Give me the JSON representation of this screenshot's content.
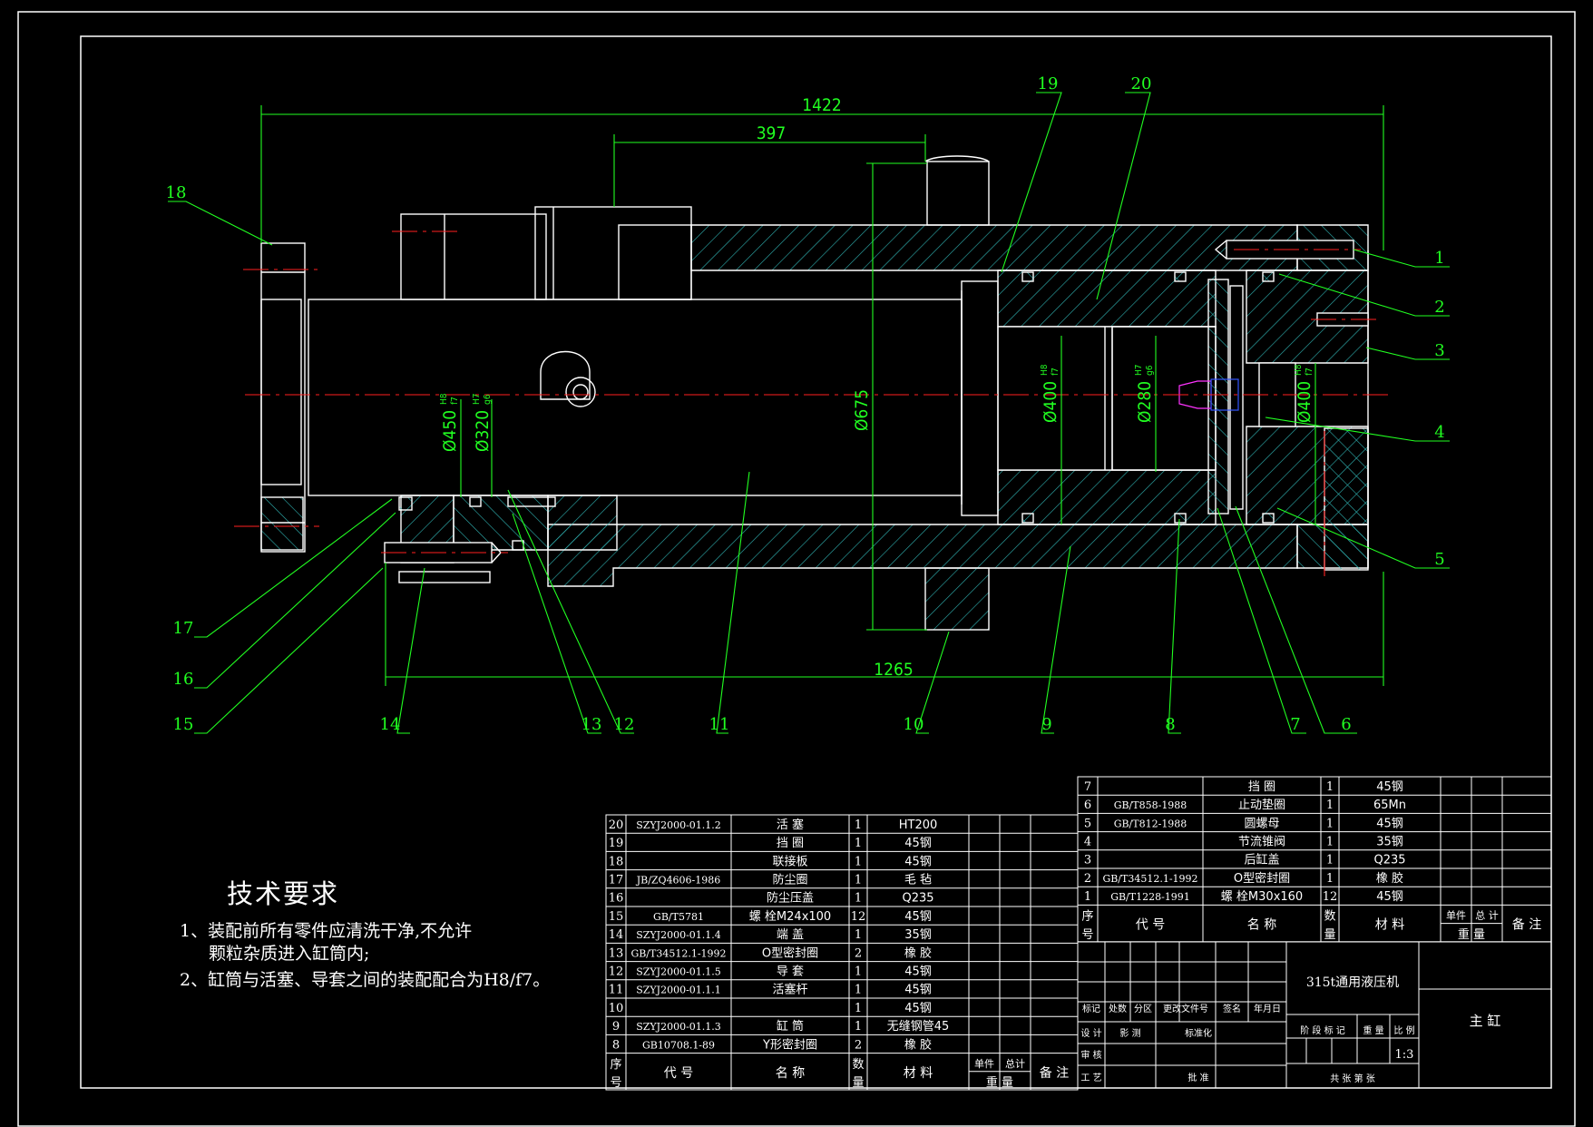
{
  "colors": {
    "background": "#000000",
    "frame": "#ffffff",
    "outline": "#ffffff",
    "dimension": "#21ff21",
    "centerline": "#ff2020",
    "hatch": "#2fb3b3",
    "accent_magenta": "#ff33ff",
    "accent_blue": "#3355ff"
  },
  "dimensions": {
    "overall_length": "1422",
    "cylinder_length": "1265",
    "flange_offset": "397",
    "diameter_flange": "Ø675",
    "diameter_gland": "Ø450",
    "gland_fit_top": "H8",
    "gland_fit_bottom": "f7",
    "diameter_rod": "Ø320",
    "rod_fit_top": "H7",
    "rod_fit_bottom": "g6",
    "diameter_bore_left": "Ø400",
    "bore_left_fit_top": "H8",
    "bore_left_fit_bottom": "f7",
    "diameter_piston_inner": "Ø280",
    "piston_fit_top": "H7",
    "piston_fit_bottom": "g6",
    "diameter_bore_right": "Ø400",
    "bore_right_fit_top": "H8",
    "bore_right_fit_bottom": "f7"
  },
  "balloons": [
    "1",
    "2",
    "3",
    "4",
    "5",
    "6",
    "7",
    "8",
    "9",
    "10",
    "11",
    "12",
    "13",
    "14",
    "15",
    "16",
    "17",
    "18",
    "19",
    "20"
  ],
  "tech_requirements": {
    "title": "技术要求",
    "line1": "1、装配前所有零件应清洗干净,不允许",
    "line1b": "颗粒杂质进入缸筒内;",
    "line2": "2、缸筒与活塞、导套之间的装配配合为H8/f7。"
  },
  "bom_left": {
    "rows": [
      {
        "no": "20",
        "code": "SZYJ2000-01.1.2",
        "name": "活 塞",
        "qty": "1",
        "material": "HT200"
      },
      {
        "no": "19",
        "code": "",
        "name": "挡 圈",
        "qty": "1",
        "material": "45钢"
      },
      {
        "no": "18",
        "code": "",
        "name": "联接板",
        "qty": "1",
        "material": "45钢"
      },
      {
        "no": "17",
        "code": "JB/ZQ4606-1986",
        "name": "防尘圈",
        "qty": "1",
        "material": "毛 毡"
      },
      {
        "no": "16",
        "code": "",
        "name": "防尘压盖",
        "qty": "1",
        "material": "Q235"
      },
      {
        "no": "15",
        "code": "GB/T5781",
        "name": "螺 栓M24x100",
        "qty": "12",
        "material": "45钢"
      },
      {
        "no": "14",
        "code": "SZYJ2000-01.1.4",
        "name": "端 盖",
        "qty": "1",
        "material": "35钢"
      },
      {
        "no": "13",
        "code": "GB/T34512.1-1992",
        "name": "O型密封圈",
        "qty": "2",
        "material": "橡 胶"
      },
      {
        "no": "12",
        "code": "SZYJ2000-01.1.5",
        "name": "导 套",
        "qty": "1",
        "material": "45钢"
      },
      {
        "no": "11",
        "code": "SZYJ2000-01.1.1",
        "name": "活塞杆",
        "qty": "1",
        "material": "45钢"
      },
      {
        "no": "10",
        "code": "",
        "name": "",
        "qty": "1",
        "material": "45钢"
      },
      {
        "no": "9",
        "code": "SZYJ2000-01.1.3",
        "name": "缸 筒",
        "qty": "1",
        "material": "无缝钢管45"
      },
      {
        "no": "8",
        "code": "GB10708.1-89",
        "name": "Y形密封圈",
        "qty": "2",
        "material": "橡 胶"
      }
    ],
    "header": {
      "no_top": "序",
      "no_bottom": "号",
      "code": "代 号",
      "name": "名 称",
      "qty_top": "数",
      "qty_bottom": "量",
      "material": "材 料",
      "unit": "单件",
      "total": "总计",
      "weight": "重 量",
      "remark": "备 注"
    }
  },
  "bom_right": {
    "rows": [
      {
        "no": "7",
        "code": "",
        "name": "挡 圈",
        "qty": "1",
        "material": "45钢"
      },
      {
        "no": "6",
        "code": "GB/T858-1988",
        "name": "止动垫圈",
        "qty": "1",
        "material": "65Mn"
      },
      {
        "no": "5",
        "code": "GB/T812-1988",
        "name": "圆螺母",
        "qty": "1",
        "material": "45钢"
      },
      {
        "no": "4",
        "code": "",
        "name": "节流锥阀",
        "qty": "1",
        "material": "35钢"
      },
      {
        "no": "3",
        "code": "",
        "name": "后缸盖",
        "qty": "1",
        "material": "Q235"
      },
      {
        "no": "2",
        "code": "GB/T34512.1-1992",
        "name": "O型密封圈",
        "qty": "1",
        "material": "橡 胶"
      },
      {
        "no": "1",
        "code": "GB/T1228-1991",
        "name": "螺 栓M30x160",
        "qty": "12",
        "material": "45钢"
      }
    ],
    "header": {
      "no_top": "序",
      "no_bottom": "号",
      "code": "代 号",
      "name": "名 称",
      "qty_top": "数",
      "qty_bottom": "量",
      "material": "材 料",
      "unit": "单件",
      "total": "总 计",
      "weight": "重 量",
      "remark": "备 注"
    }
  },
  "title_block": {
    "product": "315t通用液压机",
    "drawing_name": "主 缸",
    "scale": "1:3",
    "rev_headers": [
      "标记",
      "处数",
      "分区",
      "更改文件号",
      "签名",
      "年月日"
    ],
    "design": "设 计",
    "shadow": "影 测",
    "standardize": "标准化",
    "review": "审 核",
    "process": "工 艺",
    "approve": "批 准",
    "stage": "阶 段 标 记",
    "weight": "重 量",
    "ratio": "比 例",
    "sheets": "共   张   第   张"
  }
}
